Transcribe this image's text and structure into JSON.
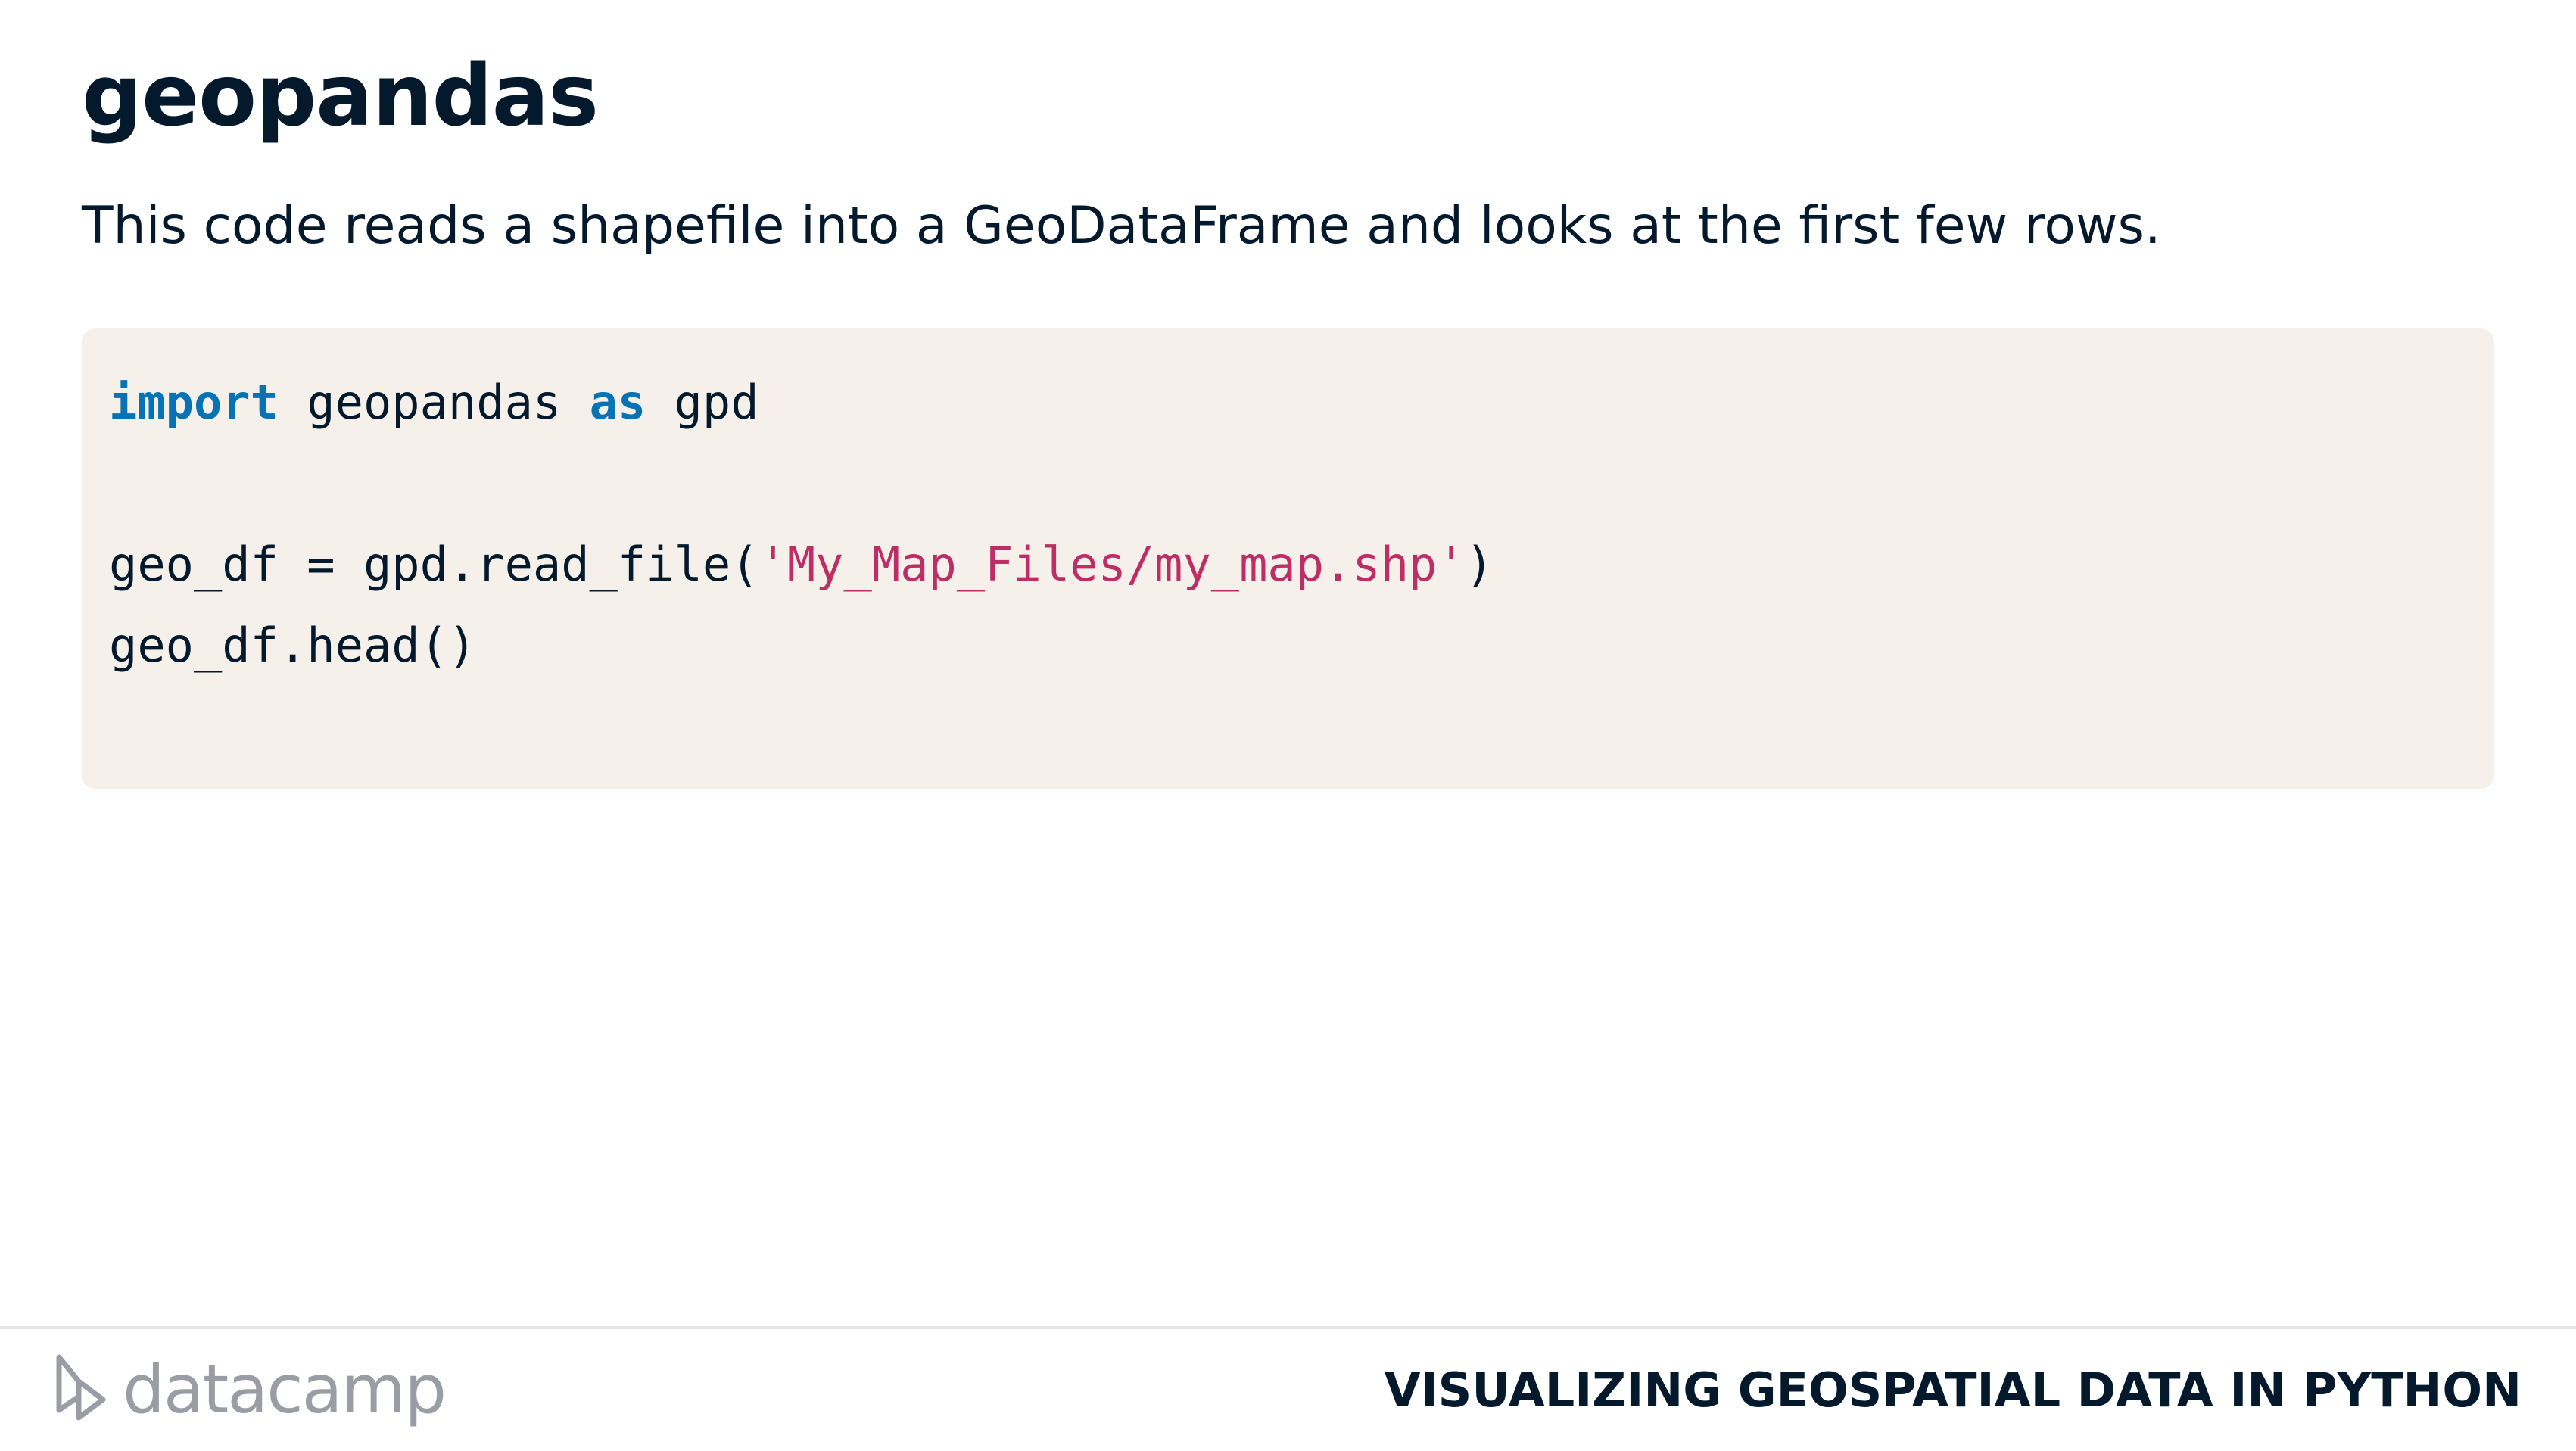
{
  "slide": {
    "title": "geopandas",
    "subtitle": "This code reads a shapefile into a GeoDataFrame and looks at the first few rows."
  },
  "code": {
    "line1": {
      "kw_import": "import",
      "module": " geopandas ",
      "kw_as": "as",
      "alias": " gpd"
    },
    "line2": "",
    "line3": {
      "prefix": "geo_df = gpd.read_file(",
      "string": "'My_Map_Files/my_map.shp'",
      "suffix": ")"
    },
    "line4": "geo_df.head()"
  },
  "footer": {
    "logo_text": "datacamp",
    "course_title": "VISUALIZING GEOSPATIAL DATA IN PYTHON"
  },
  "colors": {
    "keyword": "#0773b4",
    "string": "#bd2e67",
    "code_background": "#f5f1ea",
    "text": "#05192d",
    "logo": "#9a9da3"
  },
  "icons": {
    "logo_mark": "datacamp-logo-icon"
  }
}
